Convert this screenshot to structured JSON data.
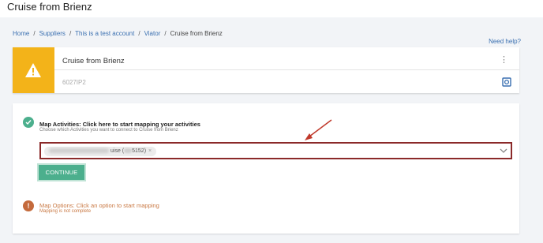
{
  "header": {
    "title": "Cruise from Brienz"
  },
  "breadcrumb": {
    "items": [
      "Home",
      "Suppliers",
      "This is a test account",
      "Viator"
    ],
    "current": "Cruise from Brienz",
    "separator": "/"
  },
  "help_link": "Need help?",
  "product": {
    "title": "Cruise from Brienz",
    "id": "6027IP2",
    "status_icon": "warning-icon",
    "status_color": "#f3b319"
  },
  "steps": {
    "map_activities": {
      "title": "Map Activities: Click here to start mapping your activities",
      "subtitle": "Choose which Activities you want to connect to Cruise from Brienz",
      "selected_chip": {
        "visible_text": "uise (",
        "code_suffix": "5152)",
        "remove": "×"
      },
      "continue_label": "CONTINUE"
    },
    "map_options": {
      "title": "Map Options: Click an option to start mapping",
      "subtitle": "Mapping is not complete"
    }
  },
  "colors": {
    "accent_green": "#4caf8d",
    "warning_orange": "#c46a3c",
    "highlight_red": "#8b2a2a",
    "link_blue": "#3a6fb0"
  }
}
